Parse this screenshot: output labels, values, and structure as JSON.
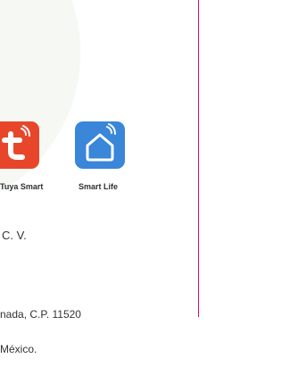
{
  "apps": [
    {
      "label": "Tuya Smart",
      "visible_label": "Tuya Smart",
      "icon": "tuya-t-icon",
      "color": "#e8462b"
    },
    {
      "label": "Smart Life",
      "icon": "smart-life-house-icon",
      "color": "#3a86d8"
    }
  ],
  "company": {
    "name_fragment": "C. V."
  },
  "address": {
    "line1": "nada, C.P. 11520",
    "line2": "México."
  },
  "colors": {
    "divider": "#e4007f",
    "background_shape": "#f6f9f3"
  }
}
